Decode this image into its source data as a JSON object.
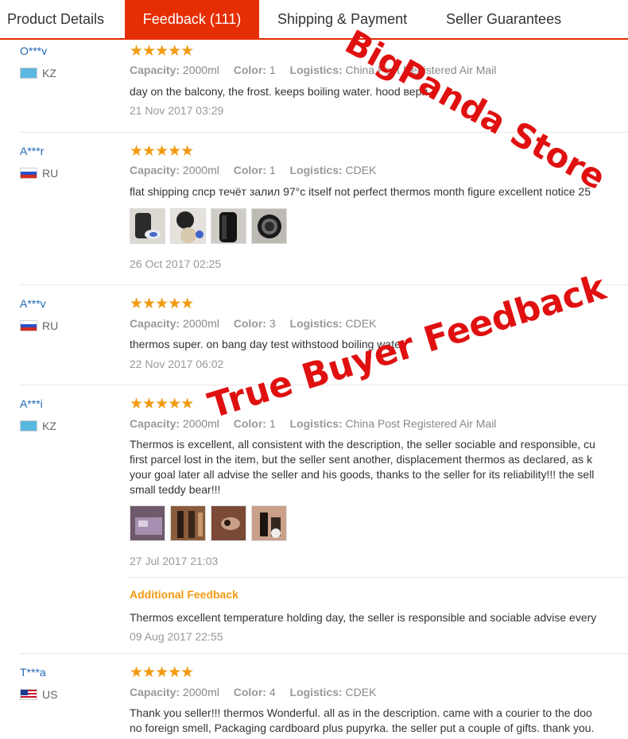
{
  "tabs": [
    "Product Details",
    "Feedback (111)",
    "Shipping & Payment",
    "Seller Guarantees"
  ],
  "labels": {
    "capacity": "Capacity:",
    "color": "Color:",
    "logistics": "Logistics:",
    "additional": "Additional Feedback"
  },
  "stars_text": "★★★★★",
  "reviews": [
    {
      "user": "O***v",
      "country": "KZ",
      "rating": 5,
      "capacity": "2000ml",
      "color": "1",
      "logistics": "China Post Registered Air Mail",
      "text": [
        "day on the balcony, the frost. keeps boiling water. hood вери."
      ],
      "date": "21 Nov 2017 03:29"
    },
    {
      "user": "A***r",
      "country": "RU",
      "rating": 5,
      "capacity": "2000ml",
      "color": "1",
      "logistics": "CDEK",
      "text": [
        "flat shipping спср течёт залил 97°c itself not perfect thermos month figure excellent notice 25"
      ],
      "date": "26 Oct 2017 02:25",
      "photos": 4
    },
    {
      "user": "A***v",
      "country": "RU",
      "rating": 5,
      "capacity": "2000ml",
      "color": "3",
      "logistics": "CDEK",
      "text": [
        "thermos super. on bang day test withstood boiling water"
      ],
      "date": "22 Nov 2017 06:02"
    },
    {
      "user": "A***i",
      "country": "KZ",
      "rating": 5,
      "capacity": "2000ml",
      "color": "1",
      "logistics": "China Post Registered Air Mail",
      "text": [
        "Thermos is excellent, all consistent with the description, the seller sociable and responsible, cu",
        "first parcel lost in the item, but the seller sent another, displacement thermos as declared, as k",
        "your goal later all advise the seller and his goods, thanks to the seller for its reliability!!! the sell",
        "small teddy bear!!!"
      ],
      "date": "27 Jul 2017 21:03",
      "photos": 4,
      "additional": {
        "text": "Thermos excellent temperature holding day, the seller is responsible and sociable advise every",
        "date": "09 Aug 2017 22:55"
      }
    },
    {
      "user": "T***a",
      "country": "US",
      "rating": 5,
      "capacity": "2000ml",
      "color": "4",
      "logistics": "CDEK",
      "text": [
        "Thank you seller!!! thermos Wonderful. all as in the description. came with a courier to the doo",
        "no foreign smell, Packaging cardboard plus pupyrka. the seller put a couple of gifts. thank you."
      ]
    }
  ],
  "watermarks": [
    "BigPanda Store",
    "True Buyer Feedback"
  ],
  "colors": {
    "accent": "#e62e04",
    "username": "#1f68b4",
    "star": "#f29a11",
    "watermark": "#e01010"
  },
  "icons": [
    "flag-kz-icon",
    "flag-ru-icon",
    "flag-us-icon",
    "star-icon"
  ]
}
